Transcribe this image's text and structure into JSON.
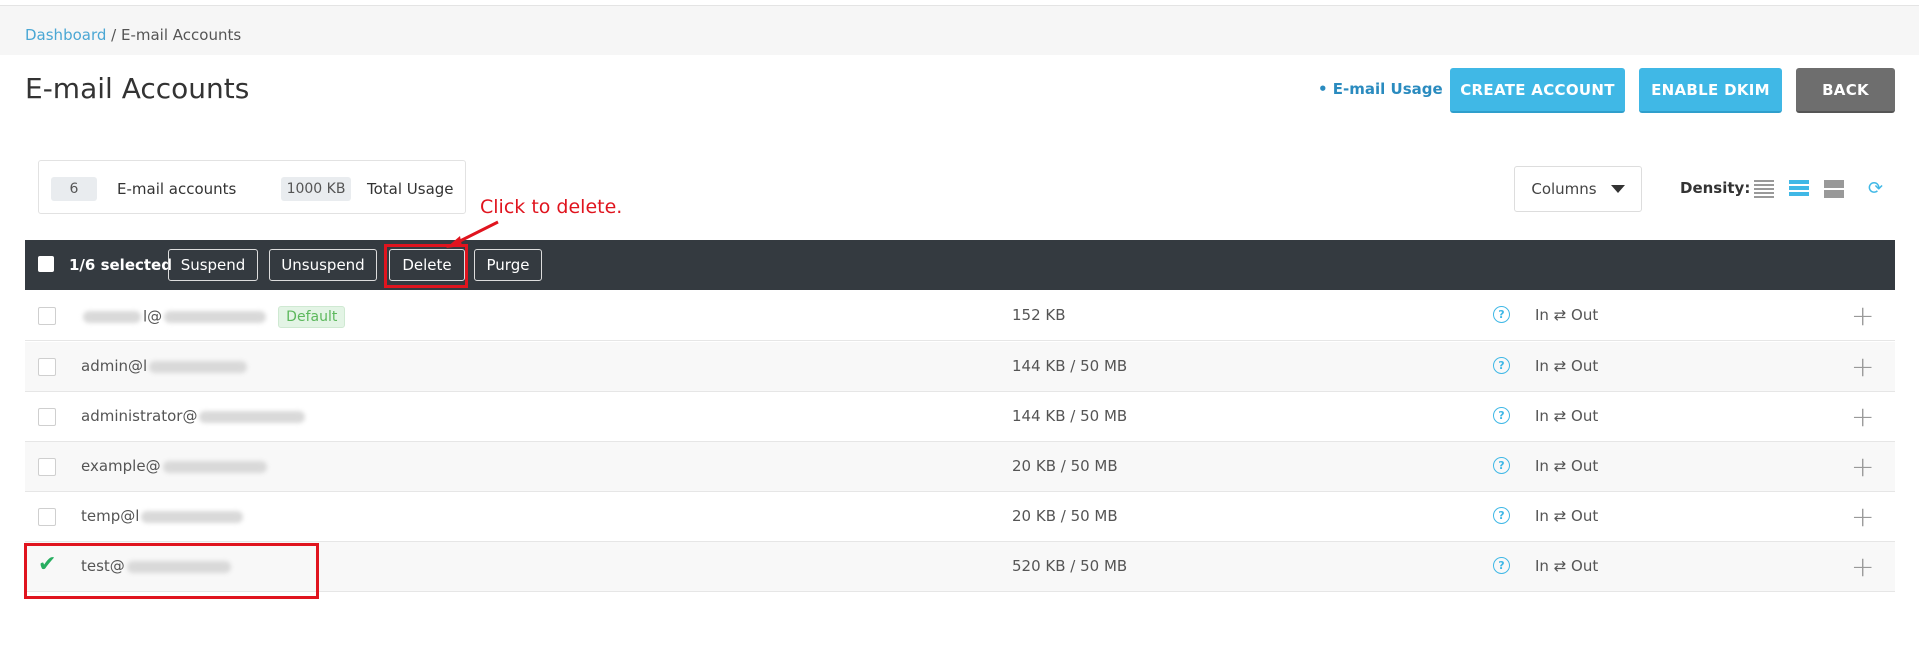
{
  "breadcrumb": {
    "home": "Dashboard",
    "separator": " / ",
    "current": "E-mail Accounts"
  },
  "page": {
    "title": "E-mail Accounts"
  },
  "header_actions": {
    "usage_link": "• E-mail Usage",
    "create_account": "CREATE ACCOUNT",
    "enable_dkim": "ENABLE DKIM",
    "back": "BACK"
  },
  "stats": {
    "accounts_count": "6",
    "accounts_label": "E-mail accounts",
    "usage_value": "1000 KB",
    "usage_label": "Total Usage"
  },
  "toolbar": {
    "columns_label": "Columns",
    "density_label": "Density:"
  },
  "bulk": {
    "selected_text": "1/6 selected",
    "suspend": "Suspend",
    "unsuspend": "Unsuspend",
    "delete": "Delete",
    "purge": "Purge"
  },
  "annotation": {
    "text": "Click to delete."
  },
  "rows": [
    {
      "email": "l@",
      "badge": "Default",
      "usage": "152 KB",
      "inout": "In ⇄ Out",
      "checked": false
    },
    {
      "email": "admin@l",
      "usage": "144 KB / 50 MB",
      "inout": "In ⇄ Out",
      "checked": false
    },
    {
      "email": "administrator@",
      "usage": "144 KB / 50 MB",
      "inout": "In ⇄ Out",
      "checked": false
    },
    {
      "email": "example@",
      "usage": "20 KB / 50 MB",
      "inout": "In ⇄ Out",
      "checked": false
    },
    {
      "email": "temp@l",
      "usage": "20 KB / 50 MB",
      "inout": "In ⇄ Out",
      "checked": false
    },
    {
      "email": "test@",
      "usage": "520 KB / 50 MB",
      "inout": "In ⇄ Out",
      "checked": true
    }
  ],
  "colors": {
    "accent": "#40b8e6",
    "bulk_bar": "#343a40",
    "annotation": "#e0141e",
    "check": "#27ae60"
  }
}
